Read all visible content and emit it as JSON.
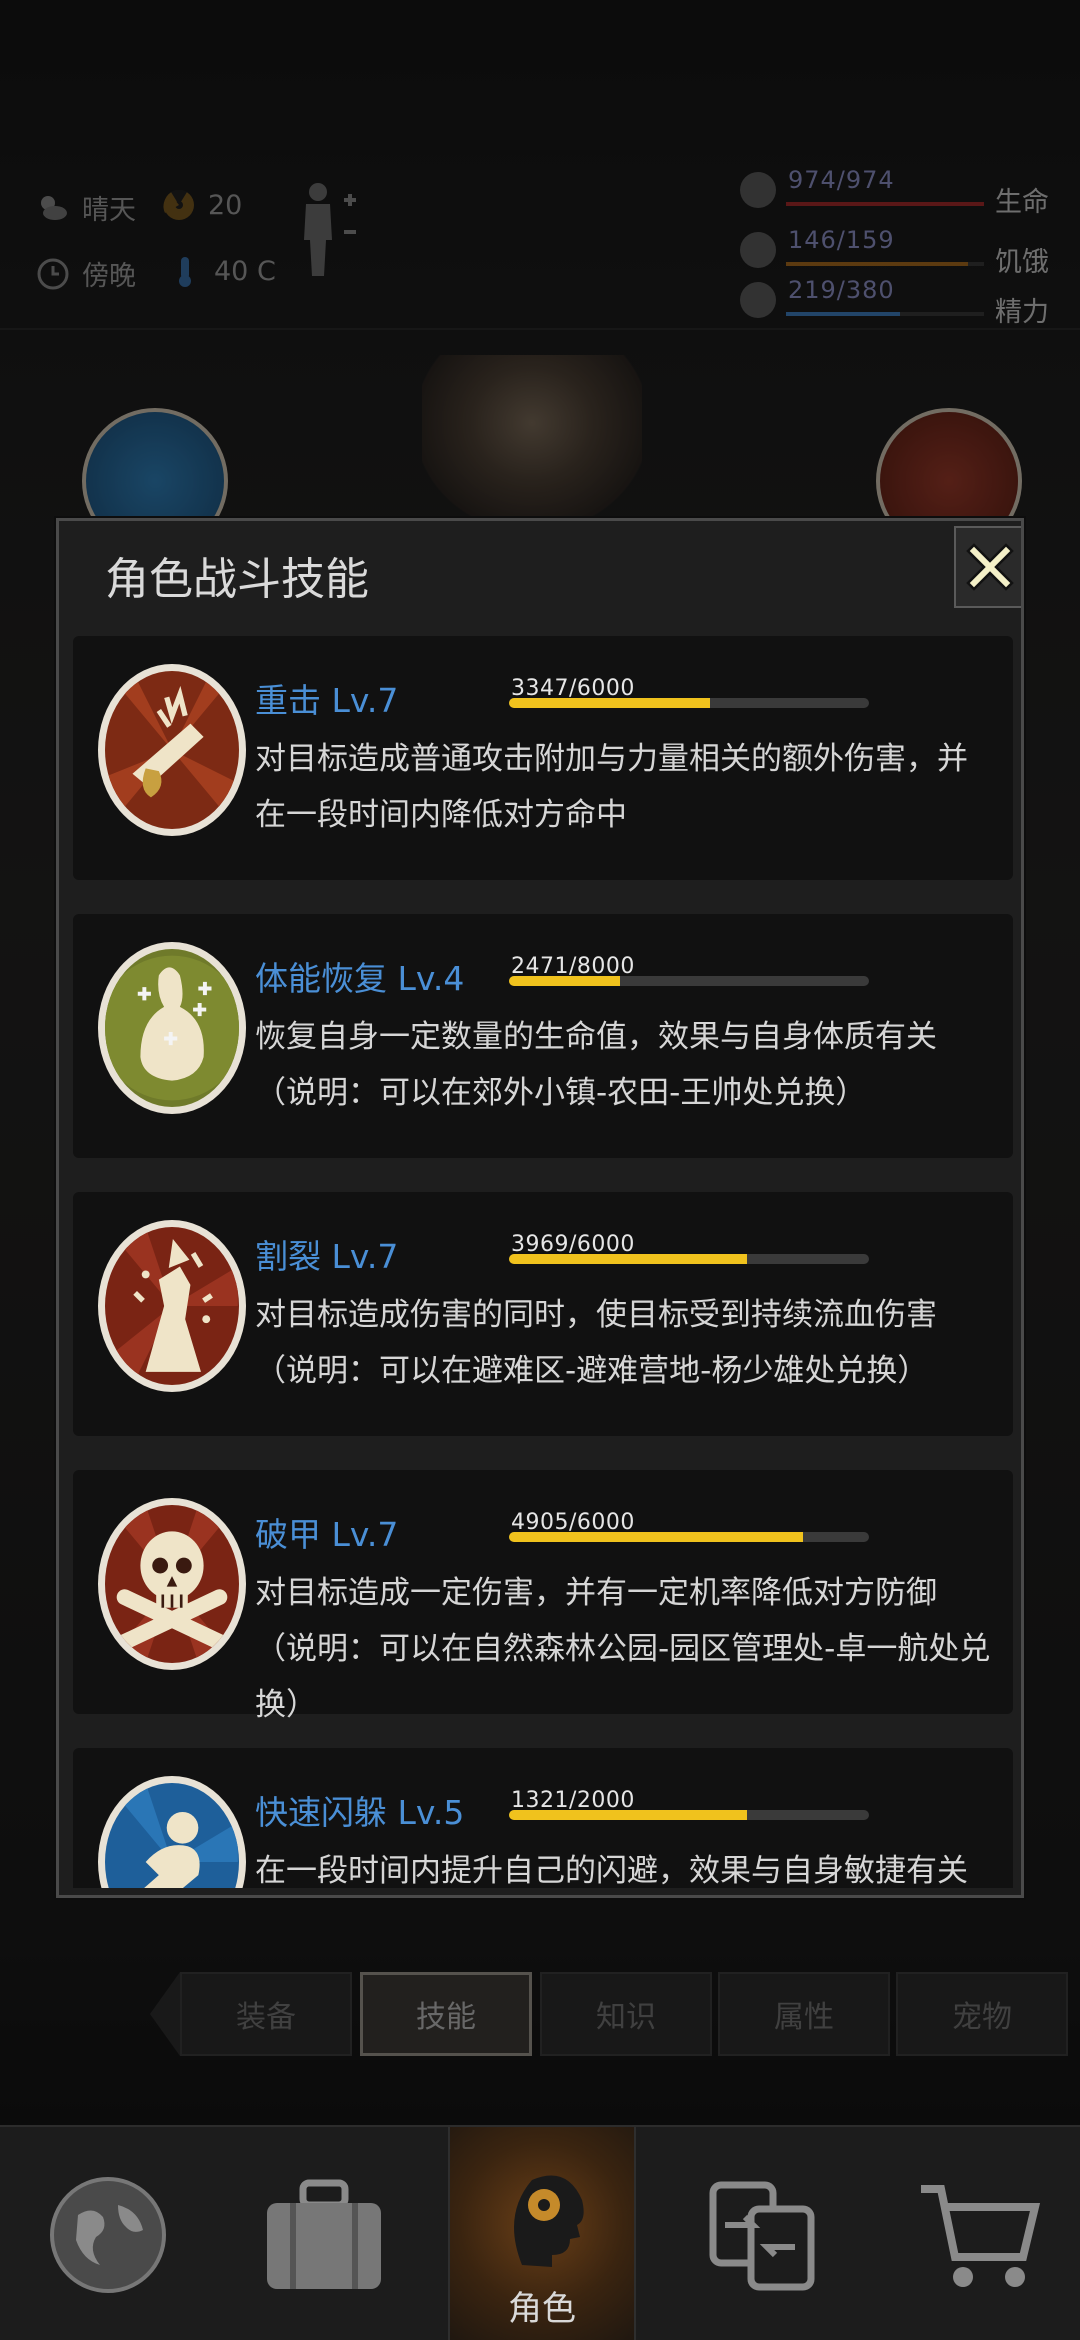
{
  "status": {
    "weather_label": "晴天",
    "radiation_value": "20",
    "time_label": "傍晚",
    "temperature_value": "40 C",
    "stats": [
      {
        "value": "974/974",
        "label": "生命",
        "fraction": 1.0,
        "color": "#a52a2a"
      },
      {
        "value": "146/159",
        "label": "饥饿",
        "fraction": 0.918,
        "color": "#a86a1e"
      },
      {
        "value": "219/380",
        "label": "精力",
        "fraction": 0.576,
        "color": "#3f7ec0"
      }
    ]
  },
  "dialog": {
    "title": "角色战斗技能",
    "skills": [
      {
        "name": "重击 Lv.7",
        "progress_text": "3347/6000",
        "progress": 0.558,
        "desc": "对目标造成普通攻击附加与力量相关的额外伤害，并在一段时间内降低对方命中",
        "icon": "heavy-strike-icon"
      },
      {
        "name": "体能恢复 Lv.4",
        "progress_text": "2471/8000",
        "progress": 0.309,
        "desc": "恢复自身一定数量的生命值，效果与自身体质有关（说明：可以在郊外小镇-农田-王帅处兑换）",
        "icon": "stamina-recovery-icon"
      },
      {
        "name": "割裂 Lv.7",
        "progress_text": "3969/6000",
        "progress": 0.662,
        "desc": "对目标造成伤害的同时，使目标受到持续流血伤害（说明：可以在避难区-避难营地-杨少雄处兑换）",
        "icon": "laceration-icon"
      },
      {
        "name": "破甲 Lv.7",
        "progress_text": "4905/6000",
        "progress": 0.818,
        "desc": "对目标造成一定伤害，并有一定机率降低对方防御（说明：可以在自然森林公园-园区管理处-卓一航处兑换）",
        "icon": "armor-break-skull-icon"
      },
      {
        "name": "快速闪躲 Lv.5",
        "progress_text": "1321/2000",
        "progress": 0.661,
        "desc": "在一段时间内提升自己的闪避，效果与自身敏捷有关",
        "icon": "quick-dodge-icon"
      }
    ]
  },
  "tabs": [
    "装备",
    "技能",
    "知识",
    "属性",
    "宠物"
  ],
  "active_tab": "技能",
  "bottom_nav": {
    "active_label": "角色",
    "items": [
      "map-globe-icon",
      "backpack-icon",
      "character-head-icon",
      "trade-exchange-icon",
      "shop-cart-icon"
    ]
  }
}
